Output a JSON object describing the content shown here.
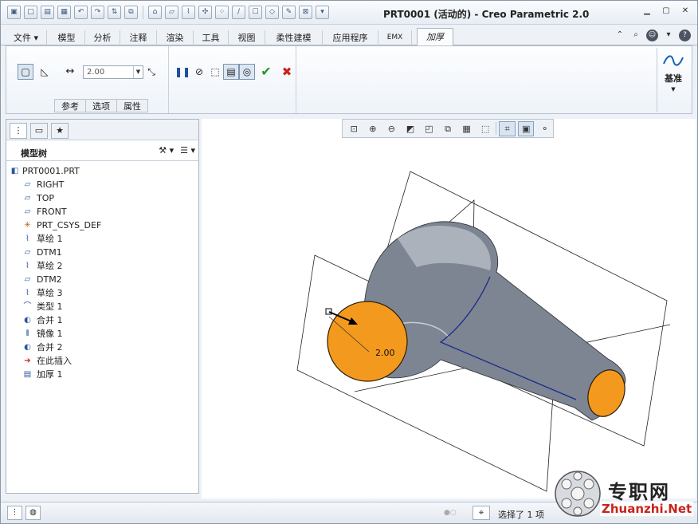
{
  "window": {
    "title": "PRT0001 (活动的) - Creo Parametric 2.0"
  },
  "ribbon_tabs": [
    {
      "label": "文件 ▾"
    },
    {
      "label": "模型"
    },
    {
      "label": "分析"
    },
    {
      "label": "注释"
    },
    {
      "label": "渲染"
    },
    {
      "label": "工具"
    },
    {
      "label": "视图"
    },
    {
      "label": "柔性建模"
    },
    {
      "label": "应用程序"
    },
    {
      "label": "EMX"
    },
    {
      "label": "加厚"
    }
  ],
  "thicken": {
    "thickness_value": "2.00",
    "subtabs": [
      "参考",
      "选项",
      "属性"
    ],
    "datum_label": "基准",
    "colors": {
      "ok": "#1d9a2a",
      "cancel": "#cc1f1a",
      "pause": "#1f4d9a"
    }
  },
  "model_tree": {
    "title": "模型树",
    "items": [
      {
        "label": "PRT0001.PRT",
        "icon": "part-icon"
      },
      {
        "label": "RIGHT",
        "icon": "datum-plane-icon"
      },
      {
        "label": "TOP",
        "icon": "datum-plane-icon"
      },
      {
        "label": "FRONT",
        "icon": "datum-plane-icon"
      },
      {
        "label": "PRT_CSYS_DEF",
        "icon": "csys-icon"
      },
      {
        "label": "草绘 1",
        "icon": "sketch-icon"
      },
      {
        "label": "DTM1",
        "icon": "datum-plane-icon"
      },
      {
        "label": "草绘 2",
        "icon": "sketch-icon"
      },
      {
        "label": "DTM2",
        "icon": "datum-plane-icon"
      },
      {
        "label": "草绘 3",
        "icon": "sketch-icon"
      },
      {
        "label": "类型 1",
        "icon": "style-icon"
      },
      {
        "label": "合并 1",
        "icon": "merge-icon"
      },
      {
        "label": "镜像 1",
        "icon": "mirror-icon"
      },
      {
        "label": "合并 2",
        "icon": "merge-icon"
      },
      {
        "label": "在此插入",
        "icon": "insert-arrow-icon"
      },
      {
        "label": "加厚 1",
        "icon": "thicken-icon"
      }
    ]
  },
  "graphics": {
    "dimension_label": "2.00",
    "colors": {
      "surface": "#7d8592",
      "thick_face": "#f39a1e",
      "edge": "#1a2a8c"
    }
  },
  "status": {
    "message": "选择了 1 项"
  },
  "watermark": {
    "title": "专职网",
    "url": "Zhuanzhi.Net"
  }
}
